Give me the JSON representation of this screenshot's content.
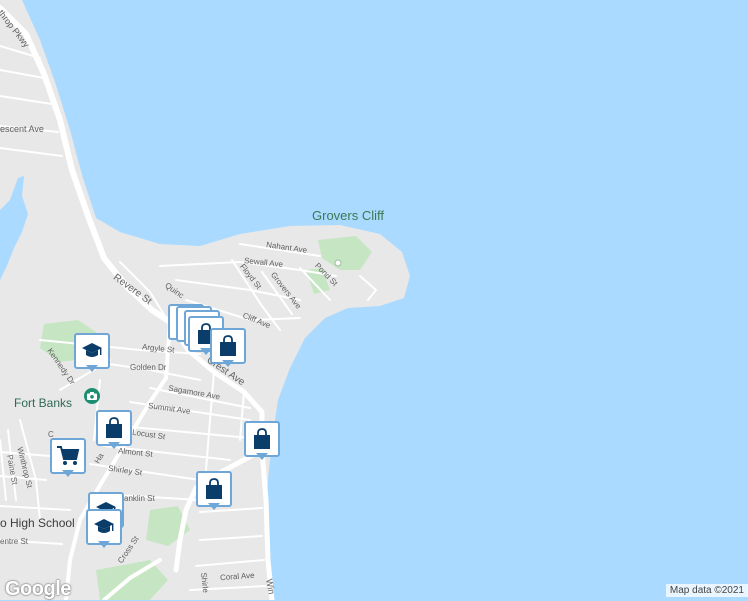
{
  "map": {
    "colors": {
      "water": "#aadaff",
      "land": "#e8e8e8",
      "road": "#ffffff",
      "park": "#c6e6c3",
      "pin_border": "#6ea6d8",
      "pin_icon": "#0b3d6b"
    },
    "labels": {
      "grovers_cliff": "Grovers Cliff",
      "fort_banks": "Fort Banks",
      "high_school": "o High School",
      "winthrop_pkwy": "throp Pkwy",
      "crescent_ave": "escent Ave",
      "nahant_ave": "Nahant Ave",
      "sewall_ave": "Sewall Ave",
      "pond_st": "Pond St",
      "floyd_st": "Floyd St",
      "grovers_ave": "Grovers Ave",
      "cliff_ave": "Cliff Ave",
      "quincy": "Quinc",
      "revere_st": "Revere St",
      "argyle_st": "Argyle St",
      "kennedy_dr": "Kennedy Dr",
      "golden_dr": "Golden Dr",
      "crest_ave": "Crest Ave",
      "sagamore_ave": "Sagamore Ave",
      "summit_ave": "Summit Ave",
      "locust_st": "Locust St",
      "almont_st": "Almont St",
      "shirley_st": "Shirley St",
      "franklin_st": "anklin St",
      "winthrop_st": "Winthrop St",
      "paine_st": "Paine St",
      "centre_st": "entre St",
      "cross_st": "Cross St",
      "coral_ave": "Coral Ave",
      "shirley_vert": "Shirle",
      "winthrop_shore": "Win",
      "ha_fragment": "Ha",
      "ca_fragment": "C"
    },
    "pins": [
      {
        "icon": "school-icon"
      },
      {
        "icon": "shopping-bag-icon"
      },
      {
        "icon": "shopping-bag-icon"
      },
      {
        "icon": "shopping-bag-icon"
      },
      {
        "icon": "shopping-bag-icon"
      },
      {
        "icon": "shopping-bag-icon"
      },
      {
        "icon": "shopping-cart-icon"
      },
      {
        "icon": "shopping-bag-icon"
      },
      {
        "icon": "shopping-bag-icon"
      },
      {
        "icon": "school-icon"
      },
      {
        "icon": "school-icon"
      }
    ],
    "poi_icon": "camera-icon"
  },
  "footer": {
    "logo": "Google",
    "attribution": "Map data ©2021"
  }
}
